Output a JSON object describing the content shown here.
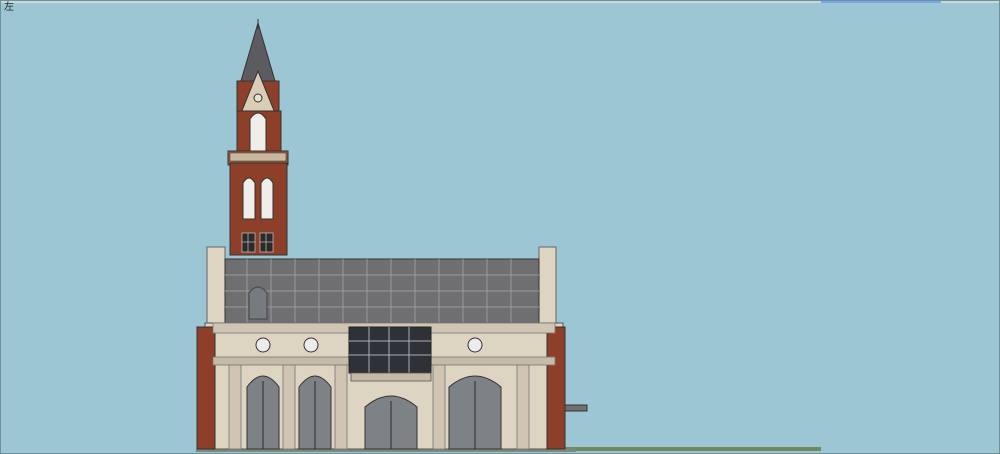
{
  "viewport": {
    "view_label": "左",
    "background_color": "#9cc6d3",
    "selection_color": "#7aa7e8"
  },
  "model": {
    "subject": "church-elevation",
    "colors": {
      "brick": "#8e3f2a",
      "brick_dark": "#6f2f20",
      "stone": "#ddd4c2",
      "stone_shadow": "#c6bba6",
      "roof": "#6f6f72",
      "glass": "#7d8287",
      "window_dark": "#2a2a2a",
      "ground": "#6f8a5f"
    },
    "icons": [
      "bell-tower-icon",
      "spire-icon",
      "clock-icon",
      "arched-window-icon"
    ]
  }
}
